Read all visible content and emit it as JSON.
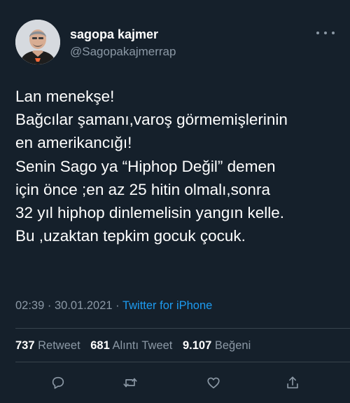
{
  "author": {
    "name": "sagopa kajmer",
    "handle": "@Sagopakajmerrap"
  },
  "tweet": {
    "lines": [
      "Lan menekşe!",
      "Bağcılar şamanı,varoş görmemişlerinin",
      "en amerikancığı!",
      "Senin Sago ya “Hiphop Değil” demen",
      "için önce ;en az 25 hitin olmalı,sonra",
      "32 yıl hiphop dinlemelisin yangın kelle.",
      "Bu ,uzaktan tepkim gocuk çocuk."
    ],
    "time": "02:39",
    "separator": " · ",
    "date": "30.01.2021",
    "source": "Twitter for iPhone"
  },
  "stats": {
    "retweets": {
      "count": "737",
      "label": "Retweet"
    },
    "quotes": {
      "count": "681",
      "label": "Alıntı Tweet"
    },
    "likes": {
      "count": "9.107",
      "label": "Beğeni"
    }
  },
  "icons": {
    "more": "more-horizontal-icon",
    "reply": "reply-icon",
    "retweet": "retweet-icon",
    "like": "heart-icon",
    "share": "share-icon"
  },
  "colors": {
    "background": "#15202b",
    "text": "#ffffff",
    "muted": "#8b98a5",
    "accent": "#1d9bf0",
    "divider": "#38444d"
  }
}
